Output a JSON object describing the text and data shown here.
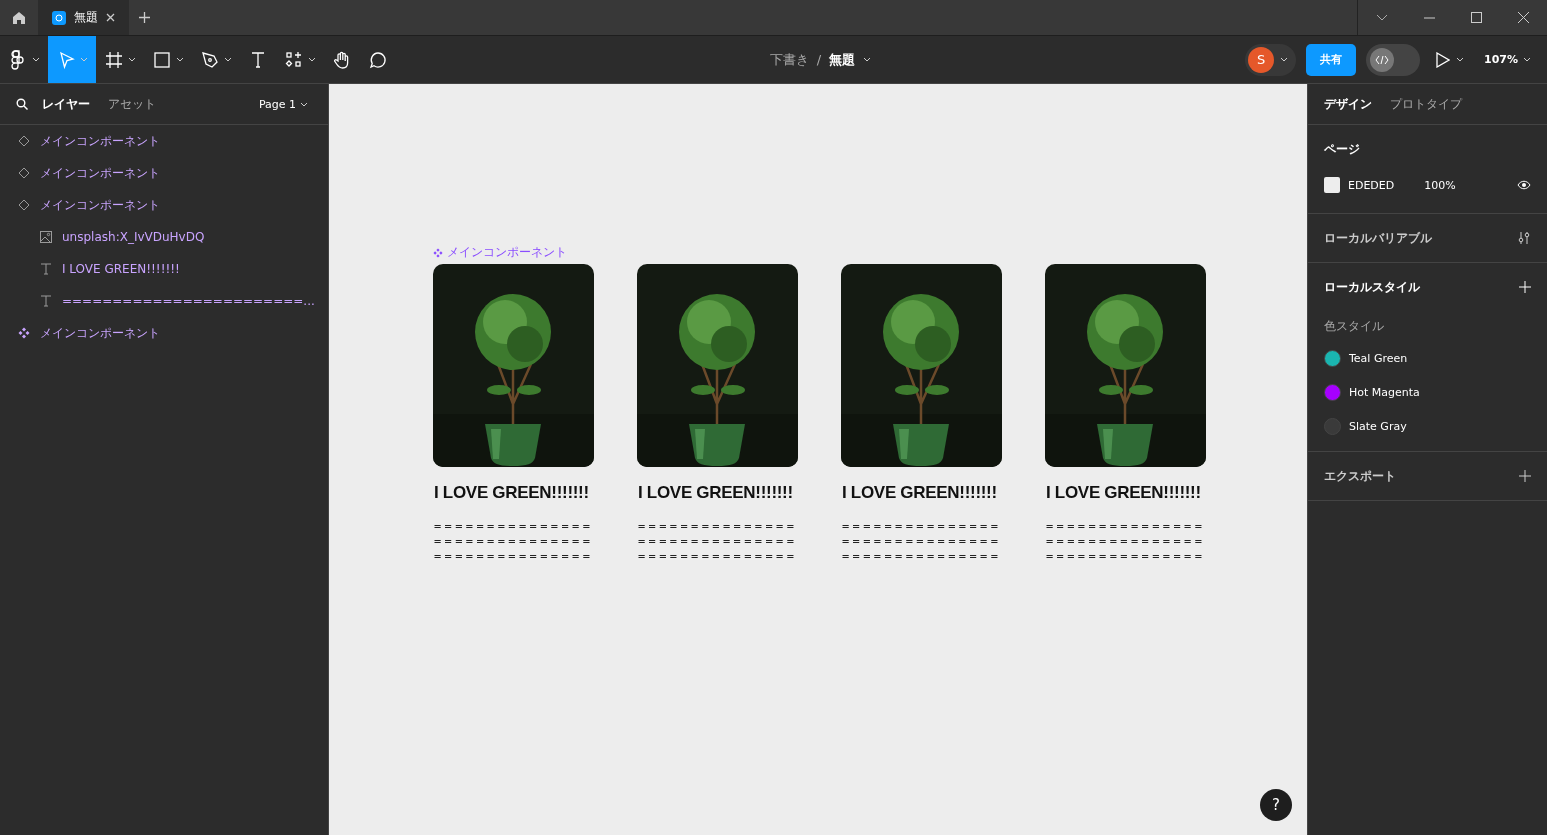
{
  "tab_bar": {
    "tabs": [
      {
        "label": "無題",
        "selected": true
      }
    ]
  },
  "toolbar": {
    "tools": [
      {
        "kind": "main-menu",
        "selected": false
      },
      {
        "kind": "move",
        "selected": true
      },
      {
        "kind": "frame",
        "selected": false
      },
      {
        "kind": "shape",
        "selected": false
      },
      {
        "kind": "pen",
        "selected": false
      },
      {
        "kind": "text",
        "selected": false
      },
      {
        "kind": "resources",
        "selected": false
      },
      {
        "kind": "hand",
        "selected": false
      },
      {
        "kind": "comment",
        "selected": false
      }
    ],
    "breadcrumb": {
      "folder": "下書き",
      "separator": "/",
      "file": "無題"
    },
    "avatar": "S",
    "share": "共有",
    "dev_mode": {
      "on": false
    },
    "zoom": "107%"
  },
  "left_panel": {
    "tabs": [
      {
        "label": "レイヤー",
        "selected": true
      },
      {
        "label": "アセット",
        "selected": false
      }
    ],
    "page": "Page 1",
    "layers": [
      {
        "kind": "instance",
        "name": "メインコンポーネント"
      },
      {
        "kind": "instance",
        "name": "メインコンポーネント"
      },
      {
        "kind": "instance",
        "name": "メインコンポーネント",
        "children": [
          {
            "kind": "image",
            "name": "unsplash:X_IvVDuHvDQ"
          },
          {
            "kind": "text",
            "name": "I LOVE GREEN!!!!!!!"
          },
          {
            "kind": "text",
            "name": "========================..."
          }
        ]
      },
      {
        "kind": "component",
        "name": "メインコンポーネント"
      }
    ]
  },
  "canvas": {
    "component_label": "メインコンポーネント",
    "cards": [
      {
        "title": "I LOVE GREEN!!!!!!!",
        "body": [
          "===============",
          "===============",
          "==============="
        ]
      },
      {
        "title": "I LOVE GREEN!!!!!!!",
        "body": [
          "===============",
          "===============",
          "==============="
        ]
      },
      {
        "title": "I LOVE GREEN!!!!!!!",
        "body": [
          "===============",
          "===============",
          "==============="
        ]
      },
      {
        "title": "I LOVE GREEN!!!!!!!",
        "body": [
          "===============",
          "===============",
          "==============="
        ]
      }
    ]
  },
  "right_panel": {
    "tabs": [
      {
        "label": "デザイン",
        "selected": true
      },
      {
        "label": "プロトタイプ",
        "selected": false
      }
    ],
    "page_section": {
      "title": "ページ",
      "color": "EDEDED",
      "opacity": "100%"
    },
    "local_variables": "ローカルバリアブル",
    "local_styles": "ローカルスタイル",
    "color_styles_label": "色スタイル",
    "color_styles": [
      {
        "name": "Teal Green",
        "color": "#1ab5b0"
      },
      {
        "name": "Hot Magenta",
        "color": "#a600ff"
      },
      {
        "name": "Slate Gray",
        "color": "#3a3a3a"
      }
    ],
    "export": "エクスポート"
  },
  "help": "?"
}
